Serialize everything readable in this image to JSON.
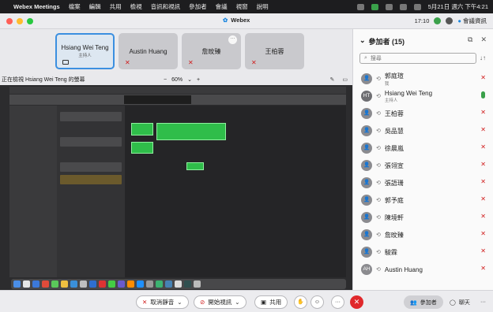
{
  "menubar": {
    "apple": "",
    "app_name": "Webex Meetings",
    "menus": [
      "檔案",
      "編輯",
      "共用",
      "檢視",
      "音訊和視訊",
      "參加者",
      "會議",
      "視窗",
      "說明"
    ],
    "clock": "5月21日 週六 下午4:21"
  },
  "window": {
    "title": "Webex",
    "time": "17:10",
    "meeting_info": "會議資訊"
  },
  "tiles": [
    {
      "name": "Hsiang Wei Teng",
      "sub": "主持人",
      "active": true
    },
    {
      "name": "Austin Huang",
      "sub": "",
      "active": false
    },
    {
      "name": "詹旼臻",
      "sub": "",
      "active": false
    },
    {
      "name": "王柏蓉",
      "sub": "",
      "active": false
    }
  ],
  "share": {
    "viewing_label": "正在檢視 Hsiang Wei Teng 的螢幕",
    "zoom_minus": "−",
    "zoom": "60%",
    "zoom_plus": "+"
  },
  "participants": {
    "header": "參加者 (15)",
    "search_placeholder": "搜尋",
    "list": [
      {
        "name": "郭庭瑄",
        "sub": "我",
        "initials": "",
        "muted": true
      },
      {
        "name": "Hsiang Wei Teng",
        "sub": "主持人",
        "initials": "HT",
        "muted": false
      },
      {
        "name": "王柏蓉",
        "sub": "",
        "initials": "",
        "muted": true
      },
      {
        "name": "吳品慧",
        "sub": "",
        "initials": "",
        "muted": true
      },
      {
        "name": "徐晨嵐",
        "sub": "",
        "initials": "",
        "muted": true
      },
      {
        "name": "張翎宣",
        "sub": "",
        "initials": "",
        "muted": true
      },
      {
        "name": "張語珊",
        "sub": "",
        "initials": "",
        "muted": true
      },
      {
        "name": "郭予庭",
        "sub": "",
        "initials": "",
        "muted": true
      },
      {
        "name": "陳境軒",
        "sub": "",
        "initials": "",
        "muted": true
      },
      {
        "name": "詹旼臻",
        "sub": "",
        "initials": "",
        "muted": true
      },
      {
        "name": "駿霖",
        "sub": "",
        "initials": "",
        "muted": true
      },
      {
        "name": "Austin Huang",
        "sub": "",
        "initials": "AH",
        "muted": true
      }
    ]
  },
  "controls": {
    "unmute": "取消靜音",
    "start_video": "開始視訊",
    "share": "共用",
    "participants": "參加者",
    "chat": "聊天",
    "more": "···"
  },
  "colors": {
    "accent": "#3b8fe0",
    "mute_red": "#d01c1c",
    "end_red": "#e0282b",
    "region_green": "#2fbd4a"
  }
}
